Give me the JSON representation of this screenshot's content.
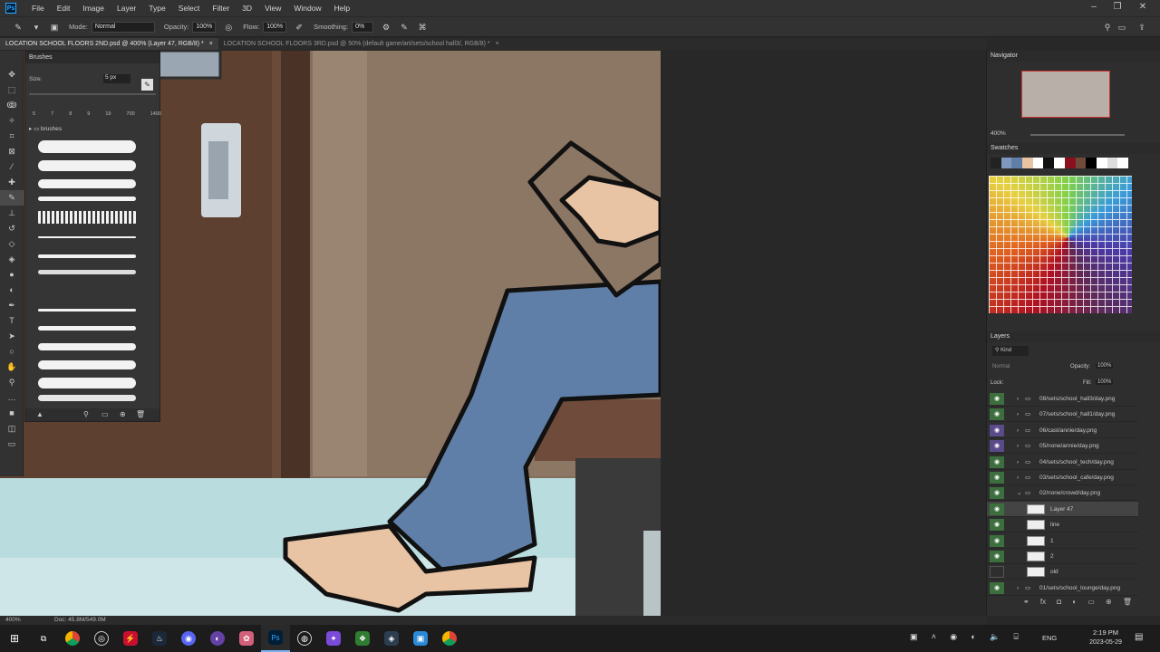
{
  "app": {
    "logo": "Ps"
  },
  "menubar": {
    "items": [
      "File",
      "Edit",
      "Image",
      "Layer",
      "Type",
      "Select",
      "Filter",
      "3D",
      "View",
      "Window",
      "Help"
    ]
  },
  "optionsbar": {
    "mode_label": "Mode:",
    "mode_value": "Normal",
    "opacity_label": "Opacity:",
    "opacity_value": "100%",
    "flow_label": "Flow:",
    "flow_value": "100%",
    "smoothing_label": "Smoothing:",
    "smoothing_value": "0%"
  },
  "tabs": [
    {
      "label": "LOCATION SCHOOL FLOORS 2ND.psd @ 400% (Layer 47, RGB/8) *",
      "close": "×"
    },
    {
      "label": "LOCATION SCHOOL FLOORS 3RD.psd @ 50% (default game/art/sets/school hall3/, RGB/8) *",
      "close": "×"
    }
  ],
  "brushes_panel": {
    "title": "Brushes",
    "size_label": "Size:",
    "size_value": "5 px",
    "presets": [
      "5",
      "7",
      "8",
      "9",
      "19",
      "700",
      "1400"
    ],
    "folder": "brushes"
  },
  "navigator": {
    "title": "Navigator",
    "zoom": "400%"
  },
  "swatches": {
    "title": "Swatches"
  },
  "layers_panel": {
    "title": "Layers",
    "filter": "Kind",
    "blend_mode": "Normal",
    "opacity_label": "Opacity:",
    "opacity_value": "100%",
    "lock_label": "Lock:",
    "fill_label": "Fill:",
    "fill_value": "100%",
    "layers": [
      {
        "name": "08/sets/school_hall3/day.png",
        "type": "group",
        "eye": "green"
      },
      {
        "name": "07/sets/school_hall1/day.png",
        "type": "group",
        "eye": "green"
      },
      {
        "name": "06/cast/annie/day.png",
        "type": "group",
        "eye": "purple"
      },
      {
        "name": "05/none/annie/day.png",
        "type": "group",
        "eye": "purple"
      },
      {
        "name": "04/sets/school_tech/day.png",
        "type": "group",
        "eye": "green"
      },
      {
        "name": "03/sets/school_cafe/day.png",
        "type": "group",
        "eye": "green"
      },
      {
        "name": "02/none/crowd/day.png",
        "type": "group-open",
        "eye": "green"
      },
      {
        "name": "Layer 47",
        "type": "layer",
        "eye": "green",
        "selected": true
      },
      {
        "name": "line",
        "type": "layer",
        "eye": "green"
      },
      {
        "name": "1",
        "type": "layer",
        "eye": "green"
      },
      {
        "name": "2",
        "type": "layer",
        "eye": "green"
      },
      {
        "name": "old",
        "type": "layer",
        "eye": "off"
      },
      {
        "name": "01/sets/school_lounge/day.png",
        "type": "group",
        "eye": "green"
      }
    ]
  },
  "statusbar": {
    "zoom": "400%",
    "doc": "Doc: 45.8M/549.0M"
  },
  "taskbar": {
    "lang": "ENG",
    "time": "2:19 PM",
    "date": "2023-05-29"
  },
  "colors": {
    "panel_bg": "#323232",
    "eye_green": "#3d6e3d",
    "eye_purple": "#5b4a8a",
    "wall": "#8a7563",
    "jeans": "#5f7fa8",
    "skin": "#e8c3a4"
  }
}
